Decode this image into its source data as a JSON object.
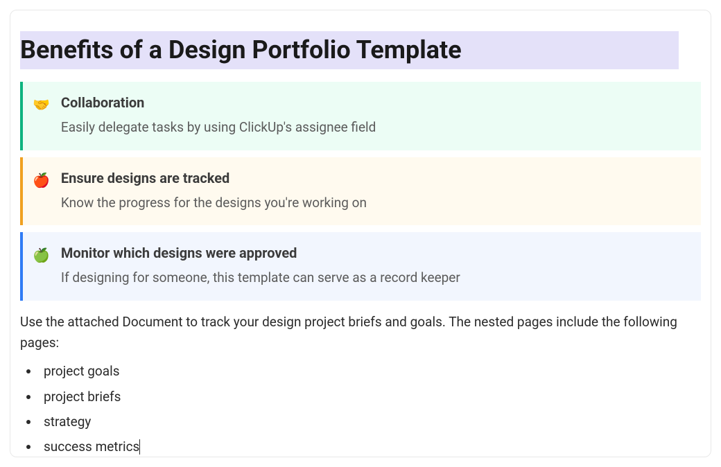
{
  "title": "Benefits of a Design Portfolio Template",
  "callouts": [
    {
      "icon": "🤝",
      "title": "Collaboration",
      "desc": "Easily delegate tasks by using ClickUp's assignee field"
    },
    {
      "icon": "🍎",
      "title": "Ensure designs are tracked",
      "desc": "Know the progress for the designs you're working on"
    },
    {
      "icon": "🍏",
      "title": "Monitor which designs were approved",
      "desc": "If designing for someone, this template can serve as a record keeper"
    }
  ],
  "body_text": "Use the attached Document to track your design project briefs and goals. The nested pages include the following pages:",
  "list_items": [
    "project goals",
    "project briefs",
    "strategy",
    "success metrics"
  ]
}
